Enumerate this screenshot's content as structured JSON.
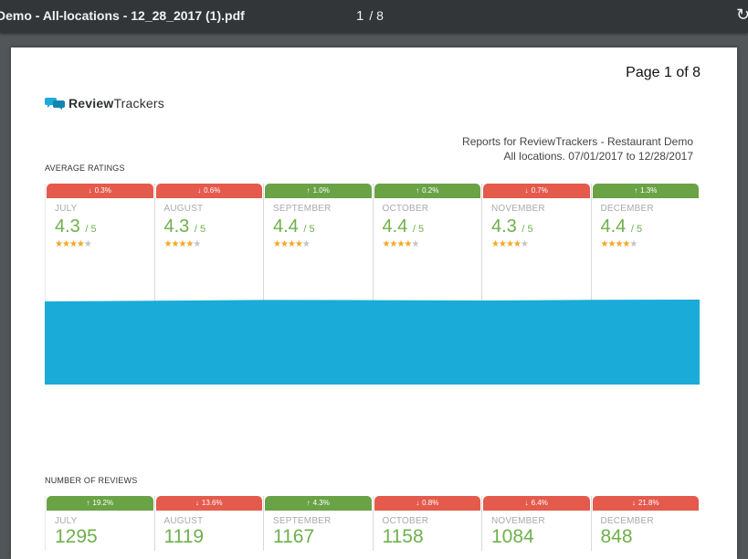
{
  "viewer": {
    "title": "Demo - All-locations - 12_28_2017 (1).pdf",
    "current_page": "1",
    "total_pages": "/ 8",
    "rotate_icon": "rotate-icon"
  },
  "page": {
    "page_of": "Page 1 of 8",
    "logo_bold": "Review",
    "logo_rest": "Trackers",
    "report_line1": "Reports for ReviewTrackers - Restaurant Demo",
    "report_line2": "All locations. 07/01/2017 to 12/28/2017"
  },
  "average_ratings": {
    "label": "AVERAGE RATINGS",
    "months": [
      {
        "month": "JULY",
        "change": "0.3%",
        "direction": "down",
        "rating": "4.3",
        "of": "/ 5",
        "stars": 4
      },
      {
        "month": "AUGUST",
        "change": "0.6%",
        "direction": "down",
        "rating": "4.3",
        "of": "/ 5",
        "stars": 4
      },
      {
        "month": "SEPTEMBER",
        "change": "1.0%",
        "direction": "up",
        "rating": "4.4",
        "of": "/ 5",
        "stars": 4
      },
      {
        "month": "OCTOBER",
        "change": "0.2%",
        "direction": "up",
        "rating": "4.4",
        "of": "/ 5",
        "stars": 4
      },
      {
        "month": "NOVEMBER",
        "change": "0.7%",
        "direction": "down",
        "rating": "4.3",
        "of": "/ 5",
        "stars": 4
      },
      {
        "month": "DECEMBER",
        "change": "1.3%",
        "direction": "up",
        "rating": "4.4",
        "of": "/ 5",
        "stars": 4
      }
    ]
  },
  "number_of_reviews": {
    "label": "NUMBER OF REVIEWS",
    "months": [
      {
        "month": "JULY",
        "change": "19.2%",
        "direction": "up",
        "count": "1295"
      },
      {
        "month": "AUGUST",
        "change": "13.6%",
        "direction": "down",
        "count": "1119"
      },
      {
        "month": "SEPTEMBER",
        "change": "4.3%",
        "direction": "up",
        "count": "1167"
      },
      {
        "month": "OCTOBER",
        "change": "0.8%",
        "direction": "down",
        "count": "1158"
      },
      {
        "month": "NOVEMBER",
        "change": "6.4%",
        "direction": "down",
        "count": "1084"
      },
      {
        "month": "DECEMBER",
        "change": "21.8%",
        "direction": "down",
        "count": "848"
      }
    ]
  },
  "colors": {
    "down": "#e45a4c",
    "up": "#6aa246",
    "value_green": "#6fb04c",
    "band_blue": "#1aabd8",
    "star_on": "#f5a623",
    "star_off": "#c4c4c4"
  }
}
